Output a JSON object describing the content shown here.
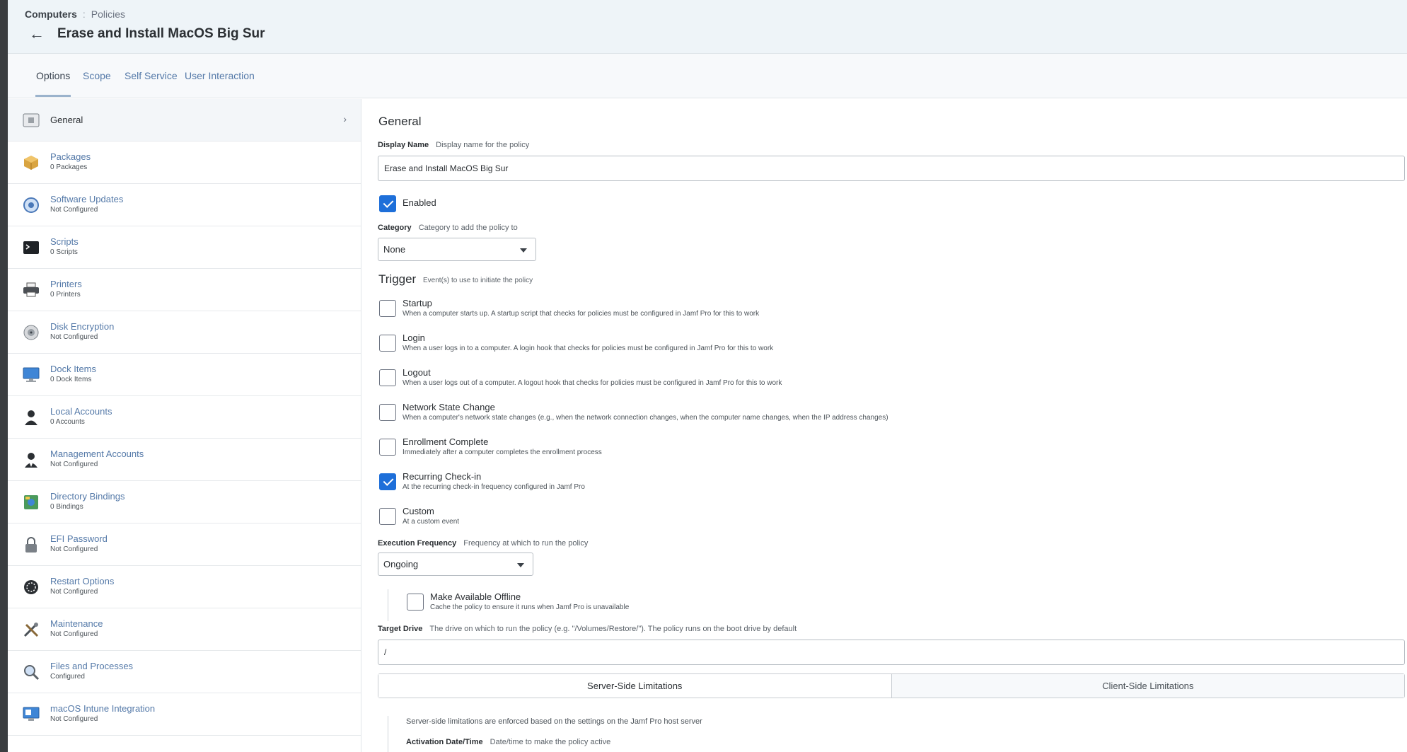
{
  "breadcrumb": {
    "root": "Computers",
    "separator": ":",
    "current": "Policies"
  },
  "page_title": "Erase and Install MacOS Big Sur",
  "tabs": [
    {
      "label": "Options"
    },
    {
      "label": "Scope"
    },
    {
      "label": "Self Service"
    },
    {
      "label": "User Interaction"
    }
  ],
  "sidebar": {
    "items": [
      {
        "label": "General",
        "sub": "",
        "icon": "general-icon"
      },
      {
        "label": "Packages",
        "sub": "0 Packages",
        "icon": "package-icon"
      },
      {
        "label": "Software Updates",
        "sub": "Not Configured",
        "icon": "software-update-icon"
      },
      {
        "label": "Scripts",
        "sub": "0 Scripts",
        "icon": "terminal-icon"
      },
      {
        "label": "Printers",
        "sub": "0 Printers",
        "icon": "printer-icon"
      },
      {
        "label": "Disk Encryption",
        "sub": "Not Configured",
        "icon": "disk-encryption-icon"
      },
      {
        "label": "Dock Items",
        "sub": "0 Dock Items",
        "icon": "dock-icon"
      },
      {
        "label": "Local Accounts",
        "sub": "0 Accounts",
        "icon": "user-icon"
      },
      {
        "label": "Management Accounts",
        "sub": "Not Configured",
        "icon": "admin-user-icon"
      },
      {
        "label": "Directory Bindings",
        "sub": "0 Bindings",
        "icon": "directory-icon"
      },
      {
        "label": "EFI Password",
        "sub": "Not Configured",
        "icon": "lock-icon"
      },
      {
        "label": "Restart Options",
        "sub": "Not Configured",
        "icon": "restart-icon"
      },
      {
        "label": "Maintenance",
        "sub": "Not Configured",
        "icon": "tools-icon"
      },
      {
        "label": "Files and Processes",
        "sub": "Configured",
        "icon": "magnifier-icon"
      },
      {
        "label": "macOS Intune Integration",
        "sub": "Not Configured",
        "icon": "intune-icon"
      }
    ]
  },
  "general": {
    "title": "General",
    "display_name": {
      "label": "Display Name",
      "desc": "Display name for the policy",
      "value": "Erase and Install MacOS Big Sur"
    },
    "enabled": {
      "label": "Enabled",
      "checked": true
    },
    "category": {
      "label": "Category",
      "desc": "Category to add the policy to",
      "value": "None"
    }
  },
  "trigger": {
    "title": "Trigger",
    "desc": "Event(s) to use to initiate the policy",
    "items": [
      {
        "label": "Startup",
        "desc": "When a computer starts up. A startup script that checks for policies must be configured in Jamf Pro for this to work",
        "checked": false
      },
      {
        "label": "Login",
        "desc": "When a user logs in to a computer. A login hook that checks for policies must be configured in Jamf Pro for this to work",
        "checked": false
      },
      {
        "label": "Logout",
        "desc": "When a user logs out of a computer. A logout hook that checks for policies must be configured in Jamf Pro for this to work",
        "checked": false
      },
      {
        "label": "Network State Change",
        "desc": "When a computer's network state changes (e.g., when the network connection changes, when the computer name changes, when the IP address changes)",
        "checked": false
      },
      {
        "label": "Enrollment Complete",
        "desc": "Immediately after a computer completes the enrollment process",
        "checked": false
      },
      {
        "label": "Recurring Check-in",
        "desc": "At the recurring check-in frequency configured in Jamf Pro",
        "checked": true
      },
      {
        "label": "Custom",
        "desc": "At a custom event",
        "checked": false
      }
    ]
  },
  "execution": {
    "label": "Execution Frequency",
    "desc": "Frequency at which to run the policy",
    "value": "Ongoing",
    "offline": {
      "label": "Make Available Offline",
      "desc": "Cache the policy to ensure it runs when Jamf Pro is unavailable",
      "checked": false
    }
  },
  "target_drive": {
    "label": "Target Drive",
    "desc": "The drive on which to run the policy (e.g. \"/Volumes/Restore/\"). The policy runs on the boot drive by default",
    "value": "/"
  },
  "limitations": {
    "tabs": [
      "Server-Side Limitations",
      "Client-Side Limitations"
    ],
    "desc": "Server-side limitations are enforced based on the settings on the Jamf Pro host server",
    "activation": {
      "label": "Activation Date/Time",
      "desc": "Date/time to make the policy active"
    }
  },
  "colors": {
    "accent": "#1e6fd9",
    "link": "#5479a8",
    "header_bg": "#eef4f8"
  }
}
